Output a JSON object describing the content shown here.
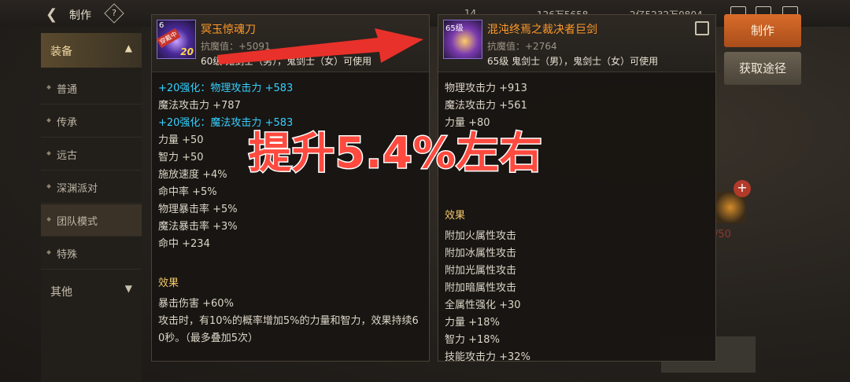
{
  "header": {
    "back_icon": "back-arrow-icon",
    "title": "制作",
    "help": "?",
    "resources": [
      "14",
      "126万5658",
      "2亿5232万0804"
    ]
  },
  "sidebar": {
    "category": "装备",
    "items": [
      {
        "label": "普通"
      },
      {
        "label": "传承"
      },
      {
        "label": "远古"
      },
      {
        "label": "深渊派对"
      },
      {
        "label": "团队模式"
      },
      {
        "label": "特殊"
      }
    ],
    "other": "其他",
    "active_index": 4
  },
  "buttons": {
    "craft": "制作",
    "acquire": "获取途径",
    "material_count": "/50"
  },
  "left_item": {
    "name": "冥玉惊魂刀",
    "resist": "抗魔值：+5091",
    "class_req": "60级 鬼剑士（男），鬼剑士（女）可使用",
    "level_tag": "6",
    "equip_tag": "穿戴中",
    "enhance_tag": "20",
    "stats": [
      {
        "text": "+20强化：物理攻击力 +583",
        "cyan": true
      },
      {
        "text": "魔法攻击力 +787",
        "cyan": false
      },
      {
        "text": "+20强化：魔法攻击力 +583",
        "cyan": true
      },
      {
        "text": "力量 +50",
        "cyan": false
      },
      {
        "text": "智力 +50",
        "cyan": false
      },
      {
        "text": "施放速度 +4%",
        "cyan": false
      },
      {
        "text": "命中率 +5%",
        "cyan": false
      },
      {
        "text": "物理暴击率 +5%",
        "cyan": false
      },
      {
        "text": "魔法暴击率 +3%",
        "cyan": false
      },
      {
        "text": "命中 +234",
        "cyan": false
      }
    ],
    "effect_title": "效果",
    "effects": [
      "暴击伤害 +60%",
      "攻击时，有10%的概率增加5%的力量和智力，效果持续6",
      "0秒。（最多叠加5次）"
    ]
  },
  "right_item": {
    "name": "混沌终焉之裁决者巨剑",
    "resist": "抗魔值：+2764",
    "class_req": "65级 鬼剑士（男），鬼剑士（女）可使用",
    "level_tag": "65级",
    "stats": [
      "物理攻击力 +913",
      "魔法攻击力 +561",
      "力量 +80"
    ],
    "effect_title": "效果",
    "effects": [
      "附加火属性攻击",
      "附加冰属性攻击",
      "附加光属性攻击",
      "附加暗属性攻击",
      "全属性强化 +30",
      "力量 +18%",
      "智力 +18%",
      "技能攻击力 +32%"
    ]
  },
  "overlay": {
    "caption": "提升5.4%左右",
    "arrow_color": "#e8312a",
    "caption_color": "#ff4a3f"
  }
}
